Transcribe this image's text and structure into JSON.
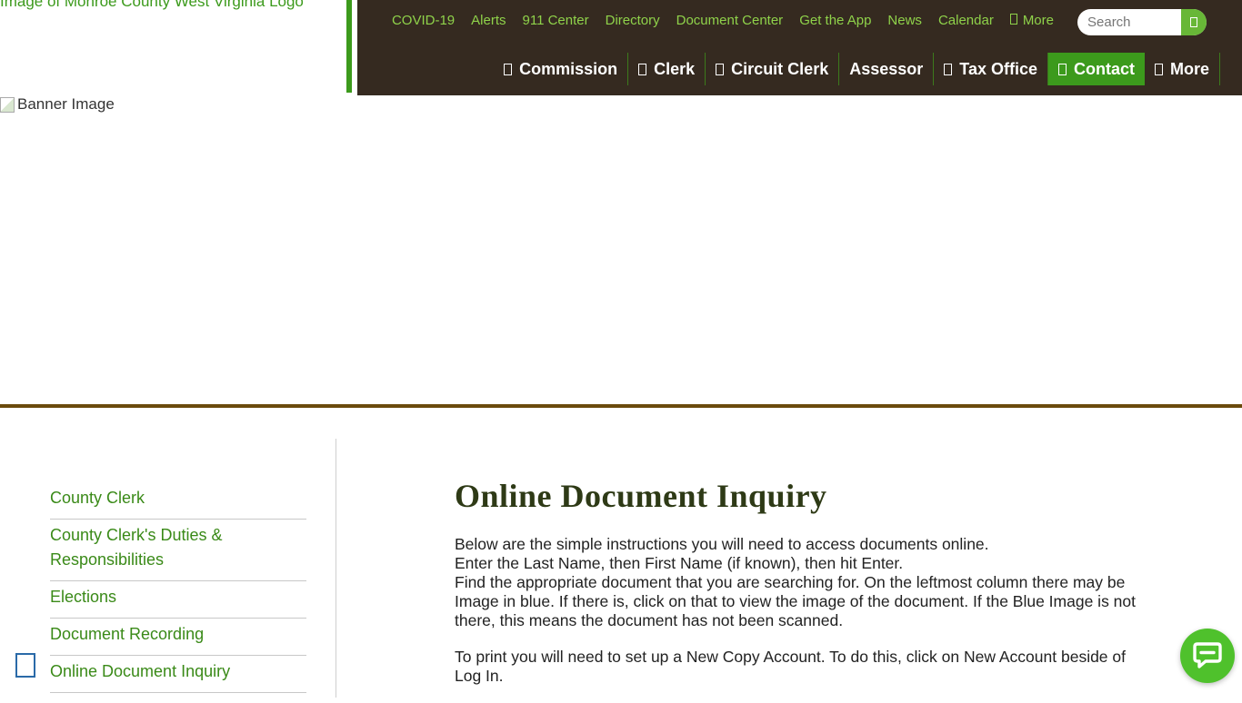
{
  "header": {
    "logo_alt": "Image of Monroe County West Virginia Logo",
    "utility_links": [
      "COVID-19",
      "Alerts",
      "911 Center",
      "Directory",
      "Document Center",
      "Get the App",
      "News",
      "Calendar",
      "More"
    ],
    "search_placeholder": "Search",
    "main_nav": [
      {
        "label": "Commission",
        "icon": "square-glyph"
      },
      {
        "label": "Clerk",
        "icon": "square-glyph"
      },
      {
        "label": "Circuit Clerk",
        "icon": "square-glyph"
      },
      {
        "label": "Assessor",
        "icon": ""
      },
      {
        "label": "Tax Office",
        "icon": "square-glyph"
      },
      {
        "label": "Contact",
        "icon": "square-glyph",
        "active": true
      },
      {
        "label": "More",
        "icon": "square-glyph"
      }
    ]
  },
  "banner": {
    "alt": "Banner Image"
  },
  "sidebar": {
    "items": [
      "County Clerk",
      "County Clerk's Duties & Responsibilities",
      "Elections",
      "Document Recording",
      "Online Document Inquiry"
    ]
  },
  "content": {
    "title": "Online Document Inquiry",
    "para1": [
      "Below are the simple instructions you will need to access documents online.",
      "Enter the Last Name, then First Name (if known), then hit Enter.",
      "Find the appropriate document that you are searching for. On the leftmost column there may be",
      "Image in blue. If there is, click on that to view the image of the document. If the Blue Image is not there, this means the document has not been scanned."
    ],
    "para2": "To print you will need to set up a New Copy Account.   To do this, click on New Account beside of Log In."
  },
  "colors": {
    "nav_bg": "#352a20",
    "accent_green": "#3c9a1c",
    "link_green": "#8fd24a",
    "title_color": "#2e3a16",
    "banner_border": "#6b4a0c"
  }
}
